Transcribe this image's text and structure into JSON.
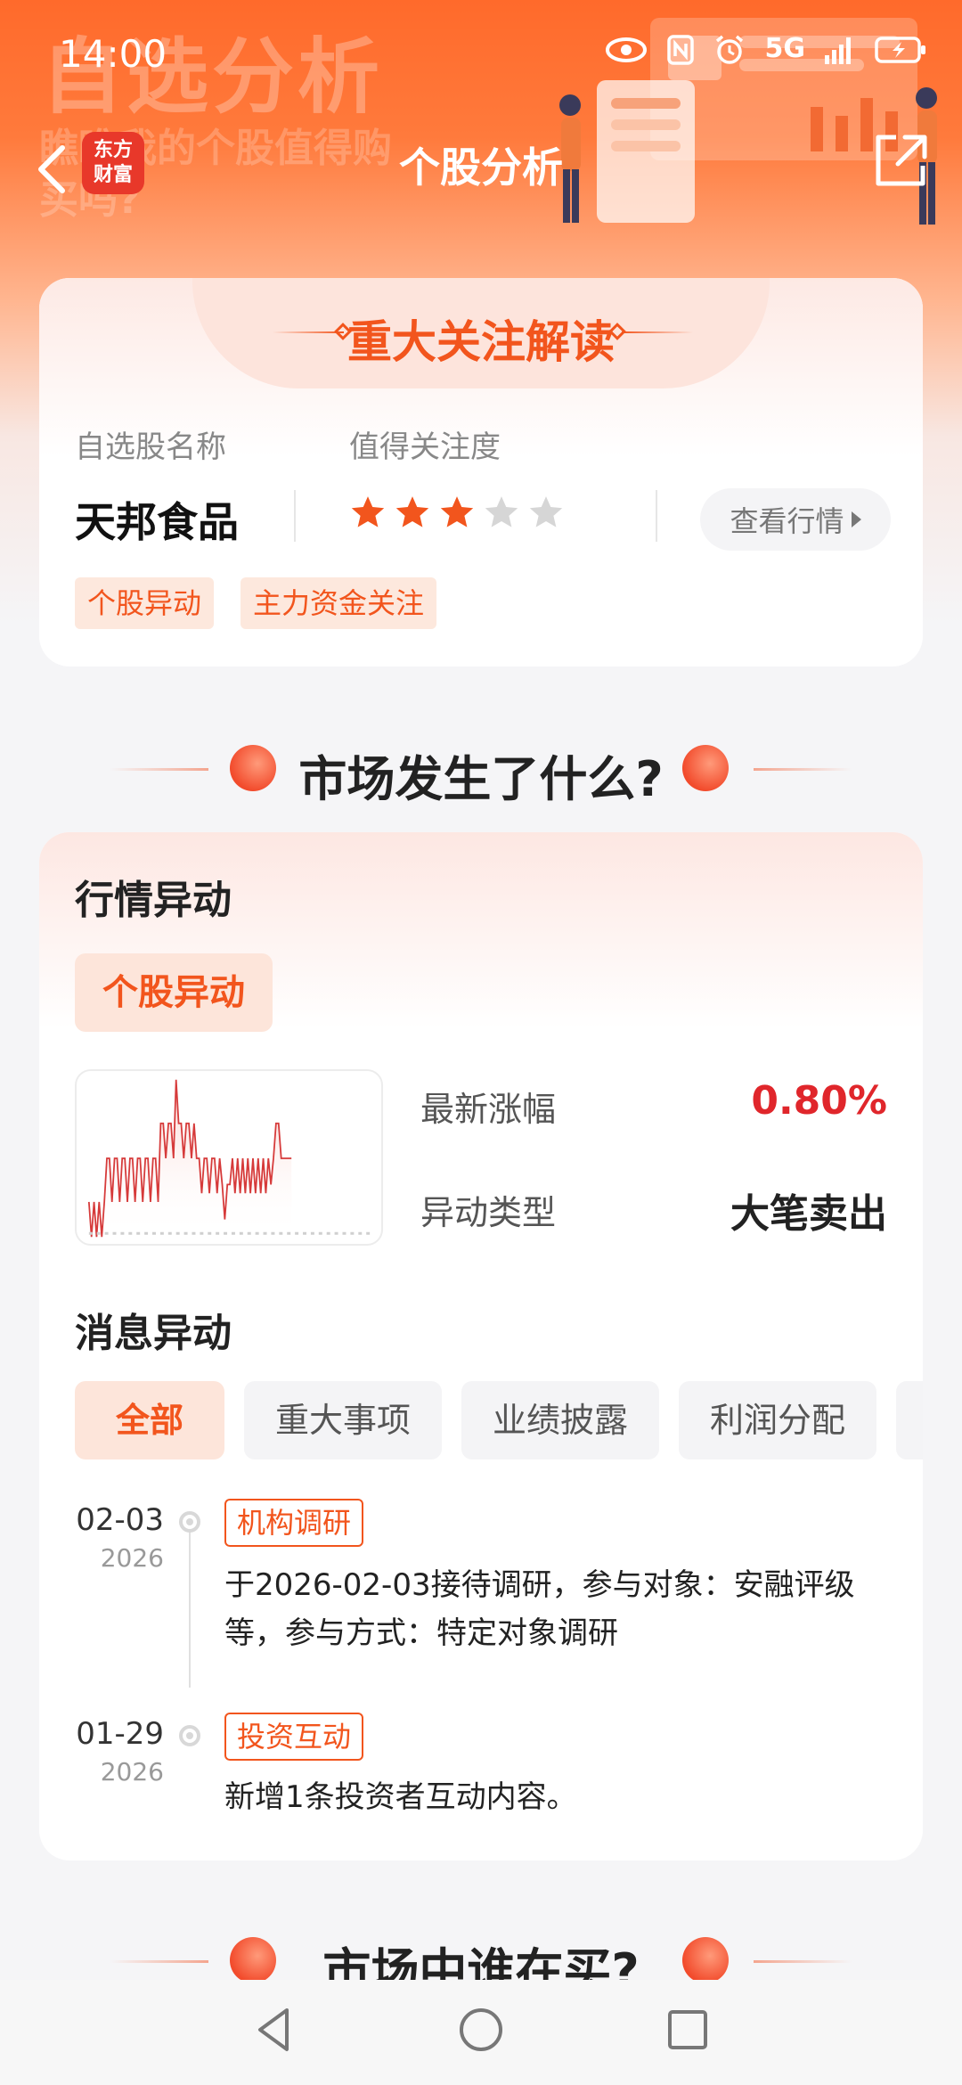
{
  "status": {
    "time": "14:00",
    "icons": [
      "eye-icon",
      "nfc-icon",
      "alarm-icon",
      "signal-5g-icon",
      "battery-icon"
    ],
    "network": "5G"
  },
  "hero": {
    "watermark_title": "自选分析",
    "watermark_line1": "瞧瞧我的个股值得购",
    "watermark_line2": "买吗?"
  },
  "nav": {
    "title": "个股分析",
    "logo_line1": "东方",
    "logo_line2": "财富"
  },
  "attention_card": {
    "title": "重大关注解读",
    "name_header": "自选股名称",
    "attention_header": "值得关注度",
    "stock_name": "天邦食品",
    "rating": 3,
    "rating_max": 5,
    "view_button": "查看行情",
    "tags": [
      "个股异动",
      "主力资金关注"
    ]
  },
  "section_market": {
    "title": "市场发生了什么?"
  },
  "market_card": {
    "quote_title": "行情异动",
    "quote_chip": "个股异动",
    "latest_change_label": "最新涨幅",
    "latest_change_value": "0.80%",
    "anomaly_type_label": "异动类型",
    "anomaly_type_value": "大笔卖出",
    "news_title": "消息异动",
    "filters": [
      "全部",
      "重大事项",
      "业绩披露",
      "利润分配"
    ],
    "timeline": [
      {
        "date": "02-03",
        "year": "2026",
        "tag": "机构调研",
        "text": "于2026-02-03接待调研，参与对象：安融评级等，参与方式：特定对象调研"
      },
      {
        "date": "01-29",
        "year": "2026",
        "tag": "投资互动",
        "text": "新增1条投资者互动内容。"
      }
    ]
  },
  "section_buyers": {
    "title": "市场中谁在买?"
  },
  "colors": {
    "accent": "#f2551d",
    "up_red": "#e0262b",
    "hero_orange": "#ff6a2b"
  },
  "bottom_nav": [
    "back-triangle-icon",
    "home-circle-icon",
    "recents-square-icon"
  ]
}
